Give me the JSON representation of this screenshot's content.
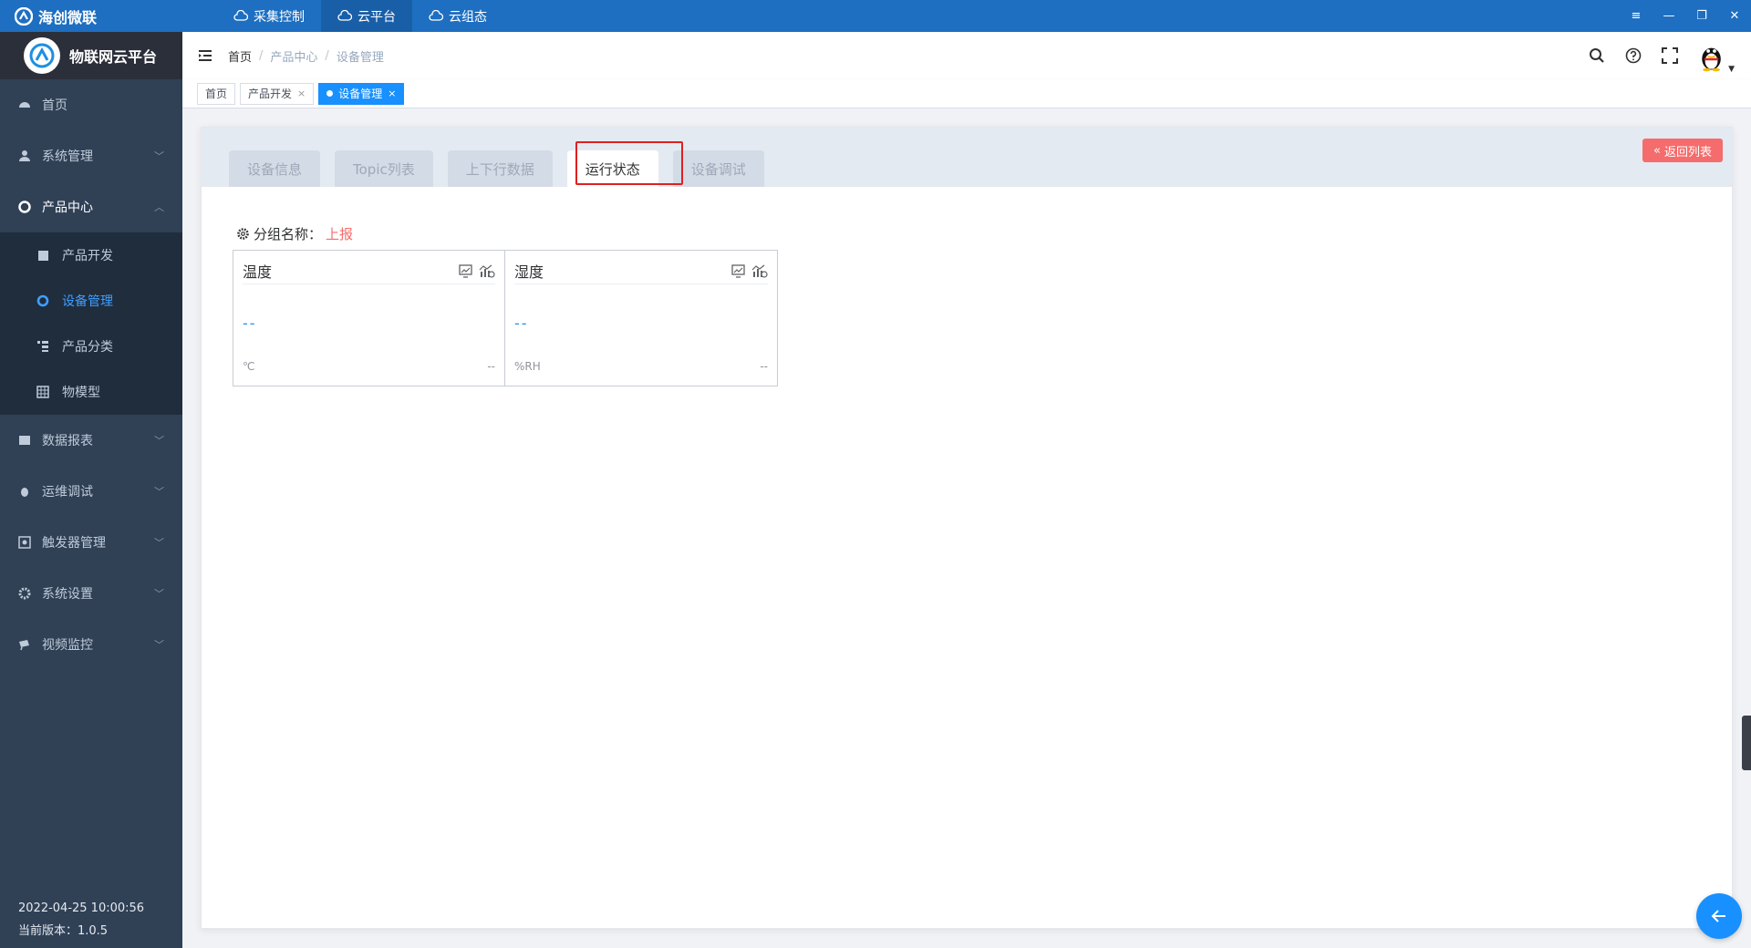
{
  "titlebar": {
    "brand": "海创微联",
    "tabs": [
      {
        "label": "采集控制",
        "active": false
      },
      {
        "label": "云平台",
        "active": true
      },
      {
        "label": "云组态",
        "active": false
      }
    ],
    "controls": {
      "menu": "≡",
      "minimize": "—",
      "restore": "❐",
      "close": "✕"
    }
  },
  "sidebar": {
    "logo_title": "物联网云平台",
    "items": [
      {
        "label": "首页",
        "icon": "dashboard-icon"
      },
      {
        "label": "系统管理",
        "icon": "user-icon"
      },
      {
        "label": "产品中心",
        "icon": "product-icon"
      },
      {
        "label": "数据报表",
        "icon": "report-icon"
      },
      {
        "label": "运维调试",
        "icon": "bug-icon"
      },
      {
        "label": "触发器管理",
        "icon": "trigger-icon"
      },
      {
        "label": "系统设置",
        "icon": "gear-icon"
      },
      {
        "label": "视频监控",
        "icon": "camera-icon"
      }
    ],
    "product_sub": [
      {
        "label": "产品开发",
        "icon": "clipboard-icon"
      },
      {
        "label": "设备管理",
        "icon": "device-icon"
      },
      {
        "label": "产品分类",
        "icon": "tree-icon"
      },
      {
        "label": "物模型",
        "icon": "table-icon"
      }
    ],
    "datetime": "2022-04-25 10:00:56",
    "version": "当前版本：1.0.5"
  },
  "navbar": {
    "breadcrumb": [
      "首页",
      "产品中心",
      "设备管理"
    ],
    "separator": "/"
  },
  "tags": [
    {
      "label": "首页",
      "active": false,
      "closable": false
    },
    {
      "label": "产品开发",
      "active": false,
      "closable": true
    },
    {
      "label": "设备管理",
      "active": true,
      "closable": true
    }
  ],
  "tag_close": "×",
  "detail": {
    "tabs": [
      "设备信息",
      "Topic列表",
      "上下行数据",
      "运行状态",
      "设备调试"
    ],
    "active_tab": "运行状态",
    "back_button": "返回列表",
    "group_label": "分组名称：",
    "group_value": "上报",
    "metrics": [
      {
        "name": "温度",
        "value": "--",
        "unit": "℃",
        "time": "--"
      },
      {
        "name": "湿度",
        "value": "--",
        "unit": "%RH",
        "time": "--"
      }
    ]
  },
  "colors": {
    "accent": "#1890ff",
    "danger": "#f56c6c",
    "titlebar": "#1e6fc1",
    "sidebar": "#304156"
  }
}
